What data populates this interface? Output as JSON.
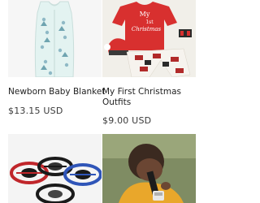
{
  "products": [
    {
      "title": "Newborn Baby Blanket",
      "price": "$13.15 USD",
      "image_icon": "sleep-sack-image"
    },
    {
      "title": "My First Christmas Outfits",
      "price": "$9.00 USD",
      "image_icon": "christmas-outfit-image",
      "image_text_line1": "My",
      "image_text_line2": "1st",
      "image_text_line3": "Christmas"
    },
    {
      "title": "",
      "price": "",
      "image_icon": "flying-spinner-toys-image"
    },
    {
      "title": "",
      "price": "",
      "image_icon": "child-microscope-image"
    }
  ],
  "colors": {
    "sack_fill": "#dff1ee",
    "outfit_red": "#d8302f",
    "plaid_dark": "#2a2a2a",
    "spinner_red": "#c0262b",
    "spinner_blue": "#2f55b8",
    "spinner_black": "#1a1a1a"
  }
}
